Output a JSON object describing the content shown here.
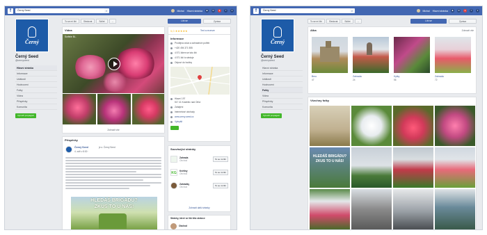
{
  "topbar": {
    "logo": "f",
    "search_value": "Černý Seed",
    "search_icon": "search-icon",
    "user_name": "Michal",
    "home_label": "Hlavní stránka"
  },
  "page": {
    "brand_logo_text": "Černý",
    "name": "Černý Seed",
    "handle": "@cernyseed",
    "nav_left": [
      "Hlavní stránka",
      "Informace",
      "Události",
      "Hodnocení",
      "Fotky",
      "Videa",
      "Příspěvky",
      "Komunita"
    ],
    "nav_right": [
      "Hlavní stránka",
      "Informace",
      "Události",
      "Hodnocení",
      "Fotky",
      "Videa",
      "Příspěvky",
      "Komunita"
    ],
    "promote_label": "Vytvořit propagaci"
  },
  "actions": {
    "like": "To se mi líbí",
    "follow": "Sledovat",
    "share": "Sdílet",
    "more": "...",
    "like_primary": "Líbí se",
    "message": "Zpráva"
  },
  "left": {
    "videos_title": "Videa",
    "video_caption": "Surfinie Bl...",
    "more_link": "Zobrazit vše",
    "rating": "5,0",
    "rating_stars": "★★★★★",
    "rating_link": "Text a recenze",
    "info_title": "Informace",
    "info_rows": [
      "Prodejna osiva a zahradních potřeb",
      "+420 494 371 555",
      "4 571 lidem se toto líbí",
      "4 571 lidí to sleduje",
      "Odpoví do hodiny"
    ],
    "address_rows": [
      "Hlavní 197",
      "517 41 Kostelec nad Orlicí",
      "Zahájení",
      "Internetové obchody",
      "www.cerny-seed.cz",
      "Vylepšit"
    ],
    "posts_title": "Příspěvky",
    "post_author": "Černý Seed",
    "post_meta": "je u: Černý Seed",
    "post_time": "4. září v 8:30 · ",
    "post_banner_line1": "HLEDÁŠ BRIGÁDU?",
    "post_banner_line2": "ZKUS TO U NÁS!",
    "related_title": "Související stránky",
    "suggestions": [
      {
        "name": "Zahrada",
        "sub": "Obchod",
        "like": "To se mi líbí"
      },
      {
        "name": "Květiny",
        "sub": "Obchod",
        "like": "To se mi líbí"
      },
      {
        "name": "Zahrádky",
        "sub": "Obchod",
        "like": "To se mi líbí"
      }
    ],
    "related_more": "Zobrazit další stránky",
    "other_title": "Stránky, které se líbí této stránce",
    "other_item": "Obchod"
  },
  "right": {
    "albums_title": "Alba",
    "albums_more": "Zobrazit vše",
    "albums": [
      {
        "name": "Brno",
        "count": "47"
      },
      {
        "name": "Zahrada",
        "count": "24"
      },
      {
        "name": "Kytky",
        "count": "56"
      },
      {
        "name": "Zahrada",
        "count": "72"
      }
    ],
    "photos_title": "Všechny fotky",
    "grid_banner_line1": "HLEDÁŠ BRIGÁDU?",
    "grid_banner_line2": "ZKUS TO U NÁS!"
  },
  "colors": {
    "fb_blue": "#4267b2",
    "brand_blue": "#1d5ba8",
    "green": "#42b72a",
    "bg": "#e9ebee"
  }
}
